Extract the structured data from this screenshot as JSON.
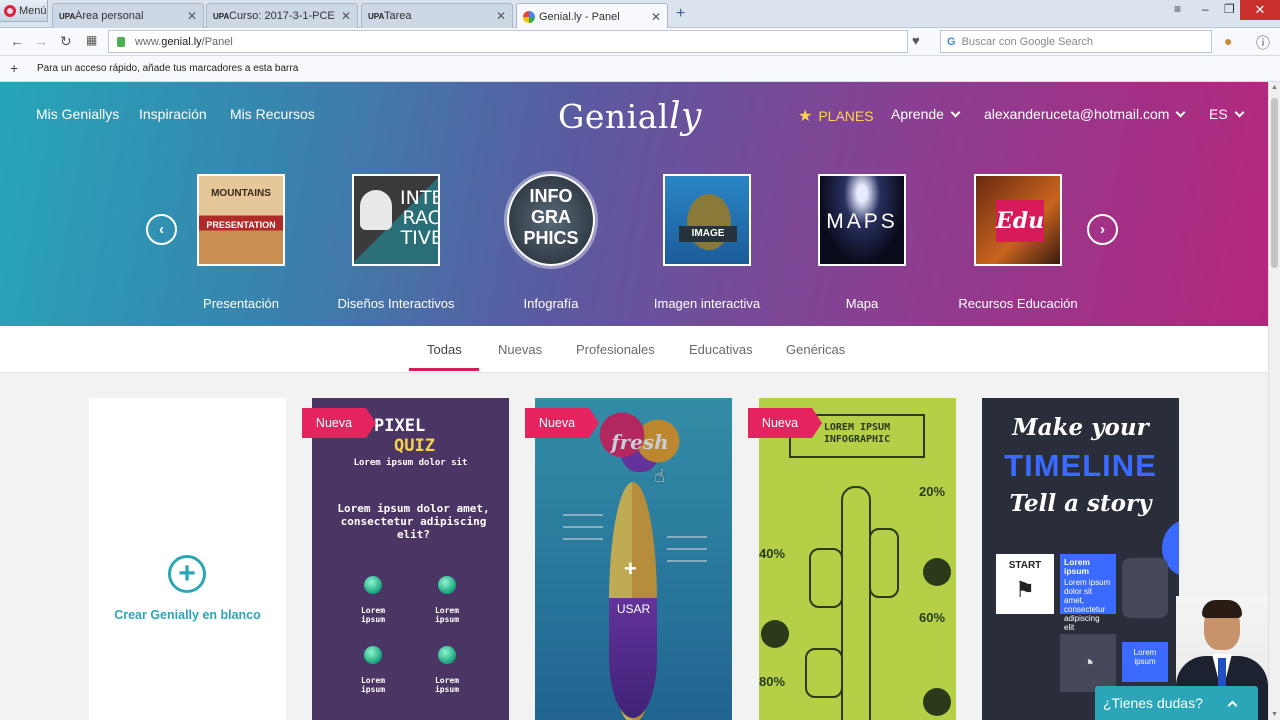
{
  "browser": {
    "menu_label": "Menú",
    "tabs": [
      {
        "title": "Área personal",
        "favicon": "UPA"
      },
      {
        "title": "Curso: 2017-3-1-PCE300-...",
        "favicon": "UPA"
      },
      {
        "title": "Tarea",
        "favicon": "UPA"
      },
      {
        "title": "Genial.ly - Panel",
        "favicon": "google-g-icon"
      }
    ],
    "url_prefix": "www.",
    "url_domain": "genial.ly",
    "url_path": "/Panel",
    "search_placeholder": "Buscar con Google Search",
    "bookmarks_hint": "Para un acceso rápido, añade tus marcadores a esta barra"
  },
  "header": {
    "nav": [
      "Mis Geniallys",
      "Inspiración",
      "Mis Recursos"
    ],
    "logo_main": "Genial",
    "logo_suffix": "ly",
    "planes": "PLANES",
    "aprende": "Aprende",
    "account": "alexanderuceta@hotmail.com",
    "lang": "ES"
  },
  "categories": [
    {
      "label": "Presentación",
      "thumb_text_1": "MOUNTAINS",
      "thumb_text_2": "PRESENTATION"
    },
    {
      "label": "Diseños Interactivos",
      "thumb_text_1": "INTE RAC TIVE"
    },
    {
      "label": "Infografía",
      "thumb_text_1": "INFO GRA PHICS"
    },
    {
      "label": "Imagen interactiva",
      "thumb_text_1": "IMAGE"
    },
    {
      "label": "Mapa",
      "thumb_text_1": "MAPS"
    },
    {
      "label": "Recursos Educación",
      "thumb_text_1": "Edu"
    }
  ],
  "filters": [
    "Todas",
    "Nuevas",
    "Profesionales",
    "Educativas",
    "Genéricas"
  ],
  "active_filter": "Todas",
  "cards": {
    "blank_label": "Crear Genially en blanco",
    "badge": "Nueva",
    "pixel": {
      "line1": "PIXEL",
      "line2": "QUIZ",
      "line3": "Lorem ipsum dolor sit",
      "question": "Lorem ipsum dolor amet, consectetur adipiscing elit?",
      "option": "Lorem ipsum"
    },
    "fresh": {
      "word": "fresh",
      "usar": "USAR"
    },
    "lorem": {
      "title": "LOREM IPSUM INFOGRAPHIC",
      "pct1": "20%",
      "pct2": "40%",
      "pct3": "60%",
      "pct4": "80%"
    },
    "timeline": {
      "line1": "Make your",
      "line2": "TIMELINE",
      "line3": "Tell a story",
      "start": "START",
      "lorem_title": "Lorem ipsum",
      "lorem_body": "Lorem ipsum dolor sit amet, consectetur adipiscing elit",
      "lorem_small": "Lorem ipsum"
    }
  },
  "chat": {
    "label": "¿Tienes dudas?"
  },
  "colors": {
    "accent": "#d8195a",
    "teal": "#2aa6b8",
    "badge": "#e5245f"
  }
}
